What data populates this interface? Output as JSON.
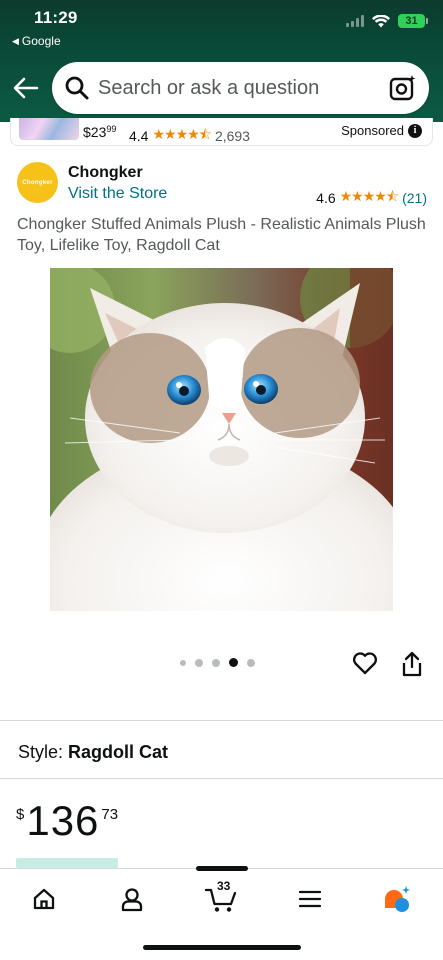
{
  "status_bar": {
    "time": "11:29",
    "back_app": "Google",
    "battery": "31"
  },
  "search": {
    "placeholder": "Search or ask a question"
  },
  "sponsored_strip": {
    "price_whole": "$23",
    "price_fraction": "99",
    "rating": "4.4",
    "stars": "★★★★⯪",
    "review_count": "2,693",
    "label": "Sponsored",
    "info_icon": "i"
  },
  "store": {
    "logo_text": "Chongker",
    "name": "Chongker",
    "link": "Visit the Store",
    "rating": "4.6",
    "stars": "★★★★⯪",
    "review_count": "(21)"
  },
  "product": {
    "title": "Chongker Stuffed Animals Plush - Realistic Animals Plush Toy, Lifelike Toy, Ragdoll Cat",
    "style_label": "Style:",
    "style_value": "Ragdoll Cat",
    "price": {
      "currency": "$",
      "whole": "136",
      "fraction": "73"
    },
    "image_count": 5,
    "active_image_index": 3
  },
  "bottom_nav": {
    "cart_count": "33",
    "items": [
      "home-icon",
      "account-icon",
      "cart-icon",
      "menu-icon",
      "ai-assistant-icon"
    ]
  },
  "colors": {
    "header_green": "#0c5a43",
    "link_teal": "#007185",
    "star_orange": "#f08804",
    "store_yellow": "#f6c21a"
  }
}
